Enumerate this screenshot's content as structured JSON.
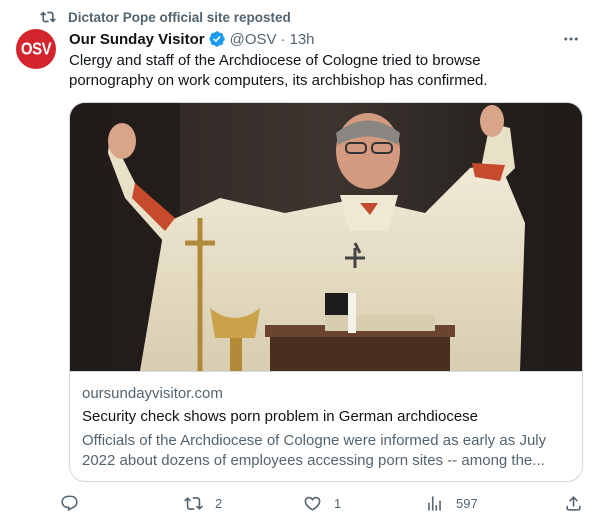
{
  "repost": {
    "label": "Dictator Pope official site reposted"
  },
  "author": {
    "avatar_text": "OSV",
    "name": "Our Sunday Visitor",
    "handle": "@OSV",
    "time": "13h"
  },
  "tweet": {
    "text": "Clergy and staff of the Archdiocese of Cologne tried to browse pornography on work computers, its archbishop has confirmed."
  },
  "card": {
    "domain": "oursundayvisitor.com",
    "title": "Security check shows porn problem in German archdiocese",
    "description": "Officials of the Archdiocese of Cologne were informed as early as July 2022 about dozens of employees accessing porn sites -- among the..."
  },
  "actions": {
    "replies": "",
    "reposts": "2",
    "likes": "1",
    "views": "597"
  },
  "colors": {
    "accent": "#1d9bf0",
    "muted": "#536471",
    "avatar": "#d4242d",
    "border": "#cfd9de"
  }
}
